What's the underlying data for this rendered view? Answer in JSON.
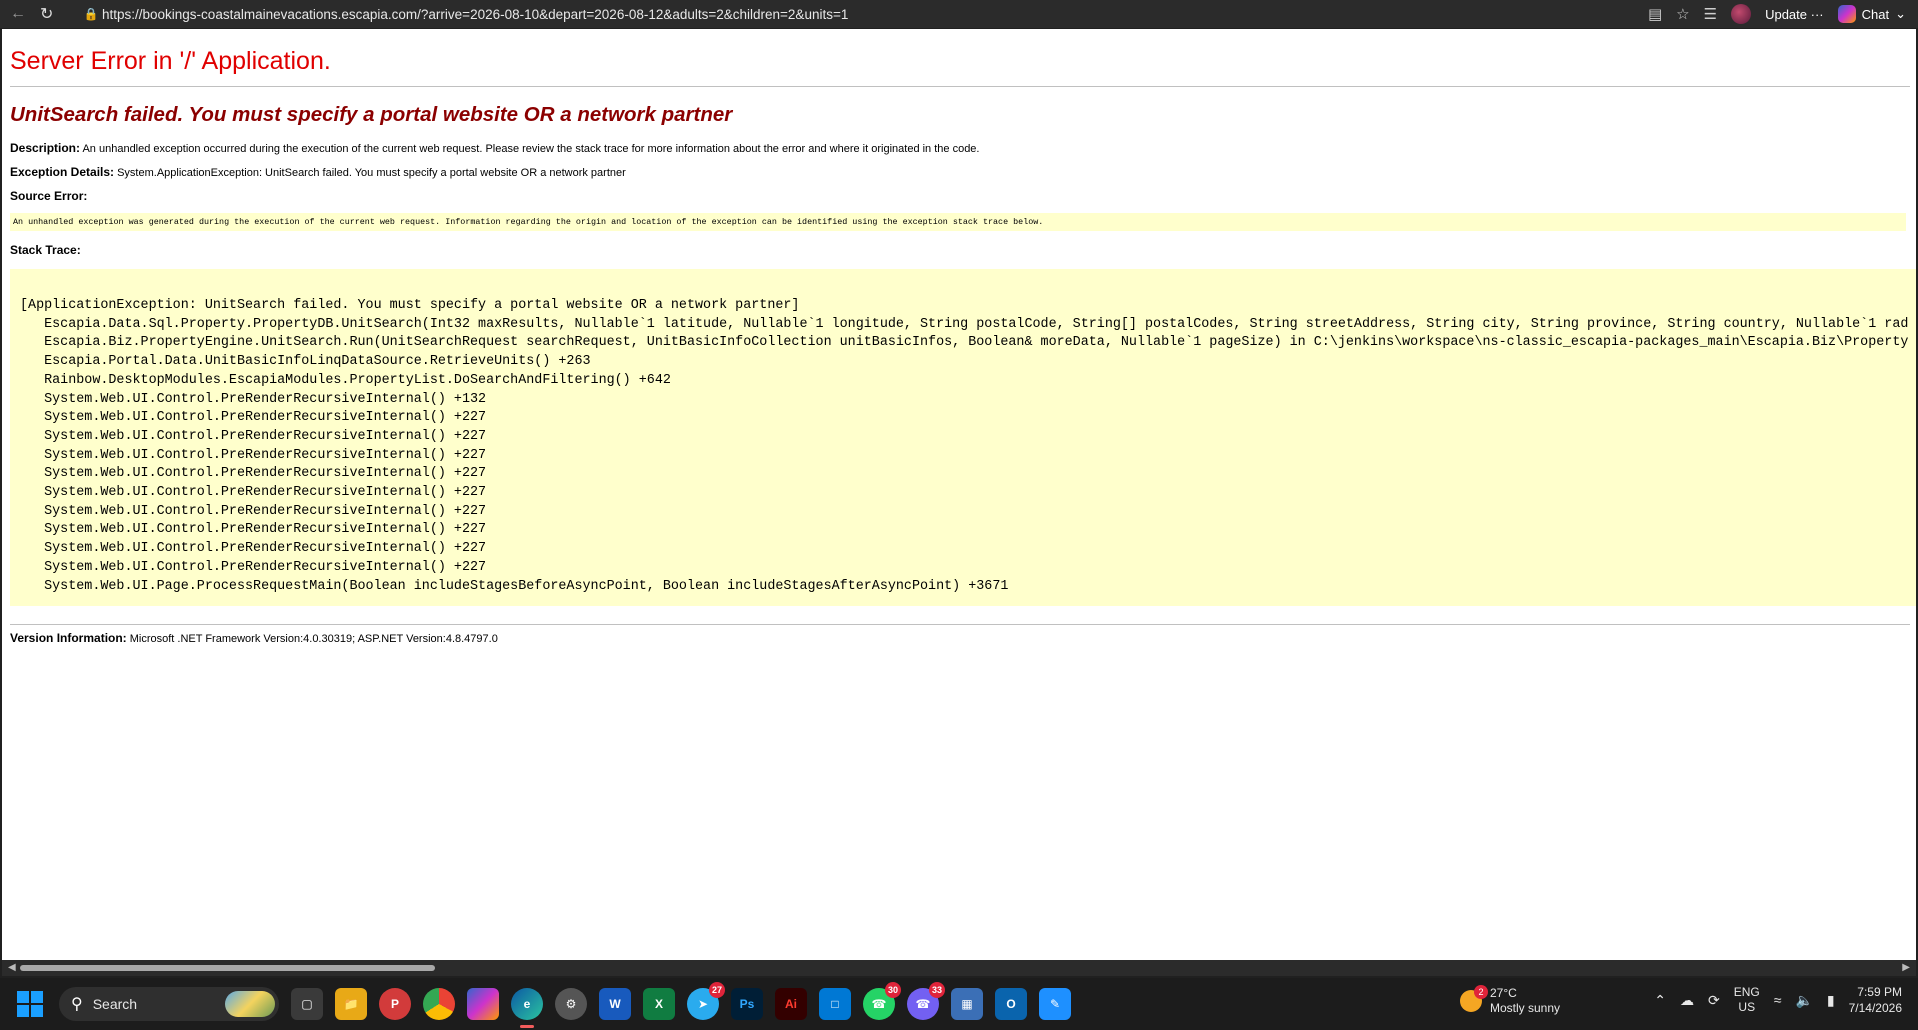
{
  "browser": {
    "url": "https://bookings-coastalmainevacations.escapia.com/?arrive=2026-08-10&depart=2026-08-12&adults=2&children=2&units=1",
    "update_label": "Update",
    "update_more": "···",
    "chat_label": "Chat"
  },
  "error": {
    "title": "Server Error in '/' Application.",
    "subtitle": "UnitSearch failed. You must specify a portal website OR a network partner",
    "description_label": "Description:",
    "description_text": " An unhandled exception occurred during the execution of the current web request. Please review the stack trace for more information about the error and where it originated in the code.",
    "exception_label": "Exception Details:",
    "exception_text": " System.ApplicationException: UnitSearch failed. You must specify a portal website OR a network partner",
    "source_label": "Source Error:",
    "source_text": "An unhandled exception was generated during the execution of the current web request. Information regarding the origin and location of the exception can be identified using the exception stack trace below.",
    "stack_label": "Stack Trace:",
    "stack_lines": [
      "[ApplicationException: UnitSearch failed. You must specify a portal website OR a network partner]",
      "   Escapia.Data.Sql.Property.PropertyDB.UnitSearch(Int32 maxResults, Nullable`1 latitude, Nullable`1 longitude, String postalCode, String[] postalCodes, String streetAddress, String city, String province, String country, Nullable`1 rad",
      "   Escapia.Biz.PropertyEngine.UnitSearch.Run(UnitSearchRequest searchRequest, UnitBasicInfoCollection unitBasicInfos, Boolean& moreData, Nullable`1 pageSize) in C:\\jenkins\\workspace\\ns-classic_escapia-packages_main\\Escapia.Biz\\Property",
      "   Escapia.Portal.Data.UnitBasicInfoLinqDataSource.RetrieveUnits() +263",
      "   Rainbow.DesktopModules.EscapiaModules.PropertyList.DoSearchAndFiltering() +642",
      "   System.Web.UI.Control.PreRenderRecursiveInternal() +132",
      "   System.Web.UI.Control.PreRenderRecursiveInternal() +227",
      "   System.Web.UI.Control.PreRenderRecursiveInternal() +227",
      "   System.Web.UI.Control.PreRenderRecursiveInternal() +227",
      "   System.Web.UI.Control.PreRenderRecursiveInternal() +227",
      "   System.Web.UI.Control.PreRenderRecursiveInternal() +227",
      "   System.Web.UI.Control.PreRenderRecursiveInternal() +227",
      "   System.Web.UI.Control.PreRenderRecursiveInternal() +227",
      "   System.Web.UI.Control.PreRenderRecursiveInternal() +227",
      "   System.Web.UI.Control.PreRenderRecursiveInternal() +227",
      "   System.Web.UI.Page.ProcessRequestMain(Boolean includeStagesBeforeAsyncPoint, Boolean includeStagesAfterAsyncPoint) +3671"
    ],
    "version_label": "Version Information:",
    "version_text": " Microsoft .NET Framework Version:4.0.30319; ASP.NET Version:4.8.4797.0"
  },
  "taskbar": {
    "search_label": "Search",
    "telegram_badge": "27",
    "whatsapp_badge": "30",
    "viber_badge": "33",
    "weather_badge": "2",
    "weather_temp": "27°C",
    "weather_desc": "Mostly sunny",
    "lang_top": "ENG",
    "lang_bottom": "US",
    "time": "7:59 PM",
    "date": "7/14/2026"
  },
  "colors": {
    "error_title": "#e00000",
    "error_subtitle": "#8b0000",
    "code_background": "#ffffcc"
  }
}
